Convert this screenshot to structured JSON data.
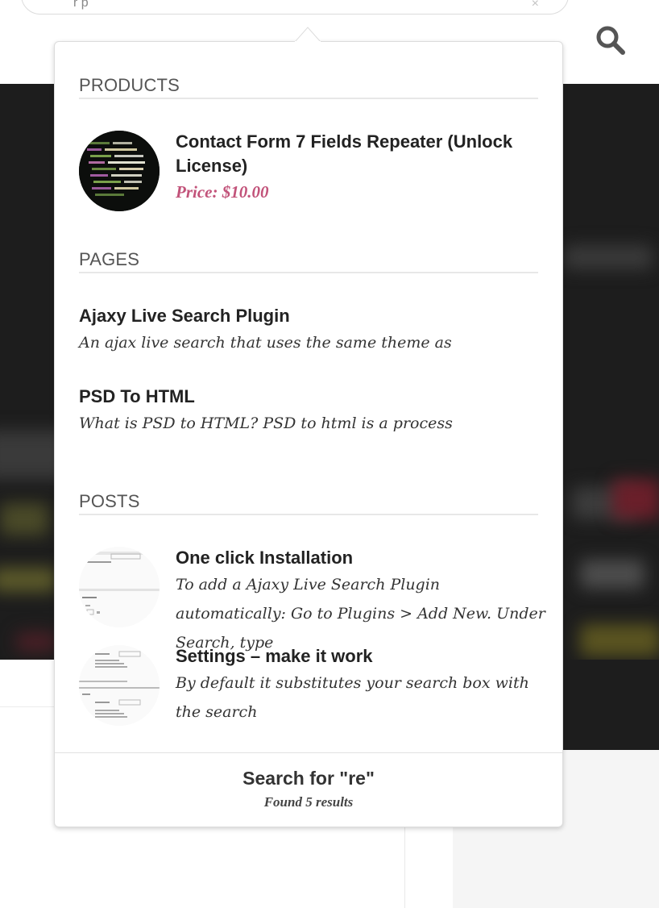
{
  "search": {
    "query": "re",
    "typed_preview": "r p",
    "clear_symbol": "×"
  },
  "results": {
    "sections": {
      "products": {
        "heading": "PRODUCTS",
        "items": [
          {
            "title": "Contact Form 7 Fields Repeater (Unlock License)",
            "price": "Price: $10.00"
          }
        ]
      },
      "pages": {
        "heading": "PAGES",
        "items": [
          {
            "title": "Ajaxy Live Search Plugin",
            "excerpt": "An ajax live search that uses the same theme as"
          },
          {
            "title": "PSD To HTML",
            "excerpt": "What is PSD to HTML? PSD to html is a process"
          }
        ]
      },
      "posts": {
        "heading": "POSTS",
        "items": [
          {
            "title": "One click Installation",
            "excerpt": "To add a Ajaxy Live Search Plugin automatically: Go to Plugins > Add New. Under Search, type"
          },
          {
            "title": "Settings – make it work",
            "excerpt": "By default it substitutes your search box with the search"
          }
        ]
      }
    },
    "footer": {
      "search_for": "Search for \"re\"",
      "found": "Found 5 results"
    }
  },
  "colors": {
    "price": "#c2537a",
    "heading": "#555555",
    "hero_bg": "#1d1d1d"
  },
  "icons": {
    "search_button": "search-icon",
    "product_thumb": "code-screenshot",
    "post_thumbs": [
      "installation-screenshot",
      "settings-screenshot"
    ]
  }
}
